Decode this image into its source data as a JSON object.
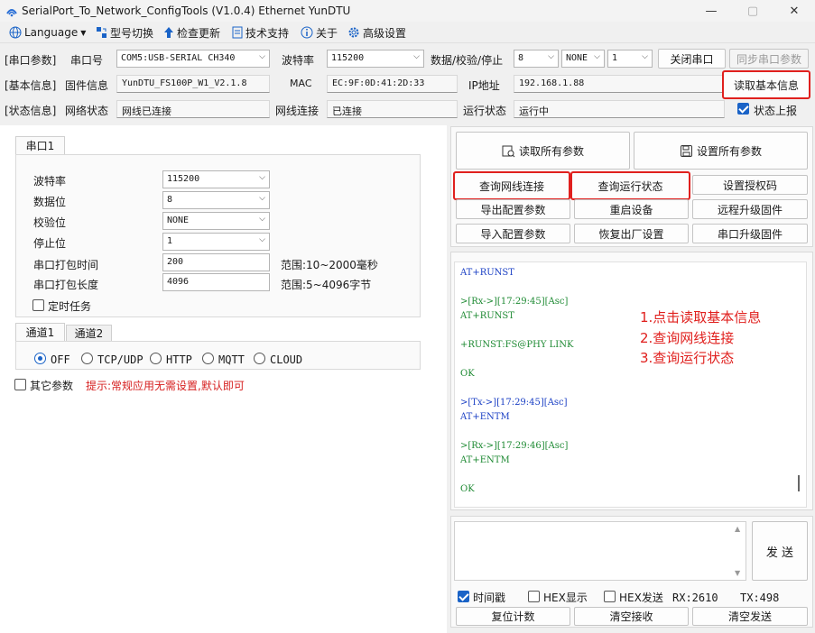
{
  "window": {
    "title": "SerialPort_To_Network_ConfigTools (V1.0.4) Ethernet YunDTU",
    "minimize": "—",
    "maximize": "▢",
    "close": "✕"
  },
  "menu": {
    "language": "Language",
    "model_switch": "型号切换",
    "check_update": "检查更新",
    "tech_support": "技术支持",
    "about": "关于",
    "advanced": "高级设置"
  },
  "serial_row": {
    "group": "[串口参数]",
    "port_label": "串口号",
    "port_value": "COM5:USB-SERIAL CH340",
    "baud_label": "波特率",
    "baud_value": "115200",
    "dps_label": "数据/校验/停止",
    "data_bits": "8",
    "parity": "NONE",
    "stop_bits": "1",
    "close_port": "关闭串口",
    "sync_params": "同步串口参数"
  },
  "info_row": {
    "group": "[基本信息]",
    "firmware_label": "固件信息",
    "firmware_value": "YunDTU_FS100P_W1_V2.1.8",
    "mac_label": "MAC",
    "mac_value": "EC:9F:0D:41:2D:33",
    "ip_label": "IP地址",
    "ip_value": "192.168.1.88",
    "read_basic": "读取基本信息"
  },
  "status_row": {
    "group": "[状态信息]",
    "net_status_label": "网络状态",
    "net_status_value": "网线已连接",
    "net_conn_label": "网线连接",
    "net_conn_value": "已连接",
    "run_label": "运行状态",
    "run_value": "运行中",
    "report_label": "状态上报"
  },
  "serial_panel": {
    "tab": "串口1",
    "baud_label": "波特率",
    "baud_value": "115200",
    "data_label": "数据位",
    "data_value": "8",
    "parity_label": "校验位",
    "parity_value": "NONE",
    "stop_label": "停止位",
    "stop_value": "1",
    "pack_time_label": "串口打包时间",
    "pack_time_value": "200",
    "pack_time_range": "范围:10~2000毫秒",
    "pack_len_label": "串口打包长度",
    "pack_len_value": "4096",
    "pack_len_range": "范围:5~4096字节",
    "timer_task": "定时任务"
  },
  "channel_panel": {
    "tab1": "通道1",
    "tab2": "通道2",
    "options": [
      "OFF",
      "TCP/UDP",
      "HTTP",
      "MQTT",
      "CLOUD"
    ]
  },
  "other": {
    "label": "其它参数",
    "hint": "提示:常规应用无需设置,默认即可"
  },
  "actions": {
    "read_all": "读取所有参数",
    "set_all": "设置所有参数",
    "query_net": "查询网线连接",
    "query_run": "查询运行状态",
    "set_auth": "设置授权码",
    "export_cfg": "导出配置参数",
    "restart": "重启设备",
    "remote_upgrade": "远程升级固件",
    "import_cfg": "导入配置参数",
    "factory_reset": "恢复出厂设置",
    "serial_upgrade": "串口升级固件"
  },
  "log": [
    {
      "text": "AT+RUNST",
      "color": "blue"
    },
    {
      "text": "",
      "color": "blue"
    },
    {
      "text": ">[Rx->][17:29:45][Asc]",
      "color": "green"
    },
    {
      "text": "AT+RUNST",
      "color": "green"
    },
    {
      "text": "",
      "color": "green"
    },
    {
      "text": "+RUNST:FS@PHY LINK",
      "color": "green"
    },
    {
      "text": "",
      "color": "green"
    },
    {
      "text": "OK",
      "color": "green"
    },
    {
      "text": "",
      "color": "green"
    },
    {
      "text": ">[Tx->][17:29:45][Asc]",
      "color": "blue"
    },
    {
      "text": "AT+ENTM",
      "color": "blue"
    },
    {
      "text": "",
      "color": "blue"
    },
    {
      "text": ">[Rx->][17:29:46][Asc]",
      "color": "green"
    },
    {
      "text": "AT+ENTM",
      "color": "green"
    },
    {
      "text": "",
      "color": "green"
    },
    {
      "text": "OK",
      "color": "green"
    }
  ],
  "annotations": [
    "1.点击读取基本信息",
    "2.查询网线连接",
    "3.查询运行状态"
  ],
  "send_panel": {
    "send": "发 送",
    "timestamp": "时间戳",
    "hex_display": "HEX显示",
    "hex_send": "HEX发送",
    "rx": "RX:2610",
    "tx": "TX:498",
    "reset_count": "复位计数",
    "clear_rx": "清空接收",
    "clear_tx": "清空发送"
  },
  "colors": {
    "highlight": "#e0201e",
    "accent": "#1a63c7",
    "log_blue": "#1a3fc4",
    "log_green": "#1e8a33"
  }
}
